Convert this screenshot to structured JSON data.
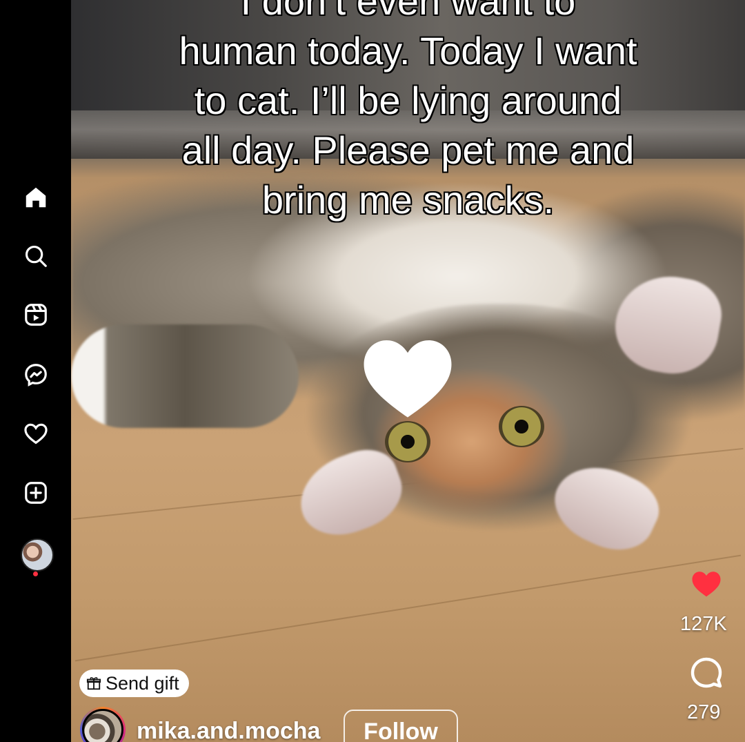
{
  "nav": {
    "items": [
      {
        "name": "home",
        "icon": "home-icon",
        "active": true
      },
      {
        "name": "search",
        "icon": "search-icon"
      },
      {
        "name": "reels",
        "icon": "reels-icon"
      },
      {
        "name": "messages",
        "icon": "messenger-icon"
      },
      {
        "name": "notifications",
        "icon": "heart-icon"
      },
      {
        "name": "create",
        "icon": "plus-square-icon"
      }
    ],
    "notification_dot_color": "#ff3040"
  },
  "reel": {
    "caption_lines": [
      "I don’t even want to",
      "human today. Today I want",
      "to cat. I’ll be lying around",
      "all day. Please pet me and",
      "bring me snacks."
    ],
    "like_count": "127K",
    "comment_count": "279",
    "liked_color": "#ff3040"
  },
  "footer": {
    "gift_label": "Send gift",
    "username": "mika.and.mocha",
    "follow_label": "Follow"
  }
}
